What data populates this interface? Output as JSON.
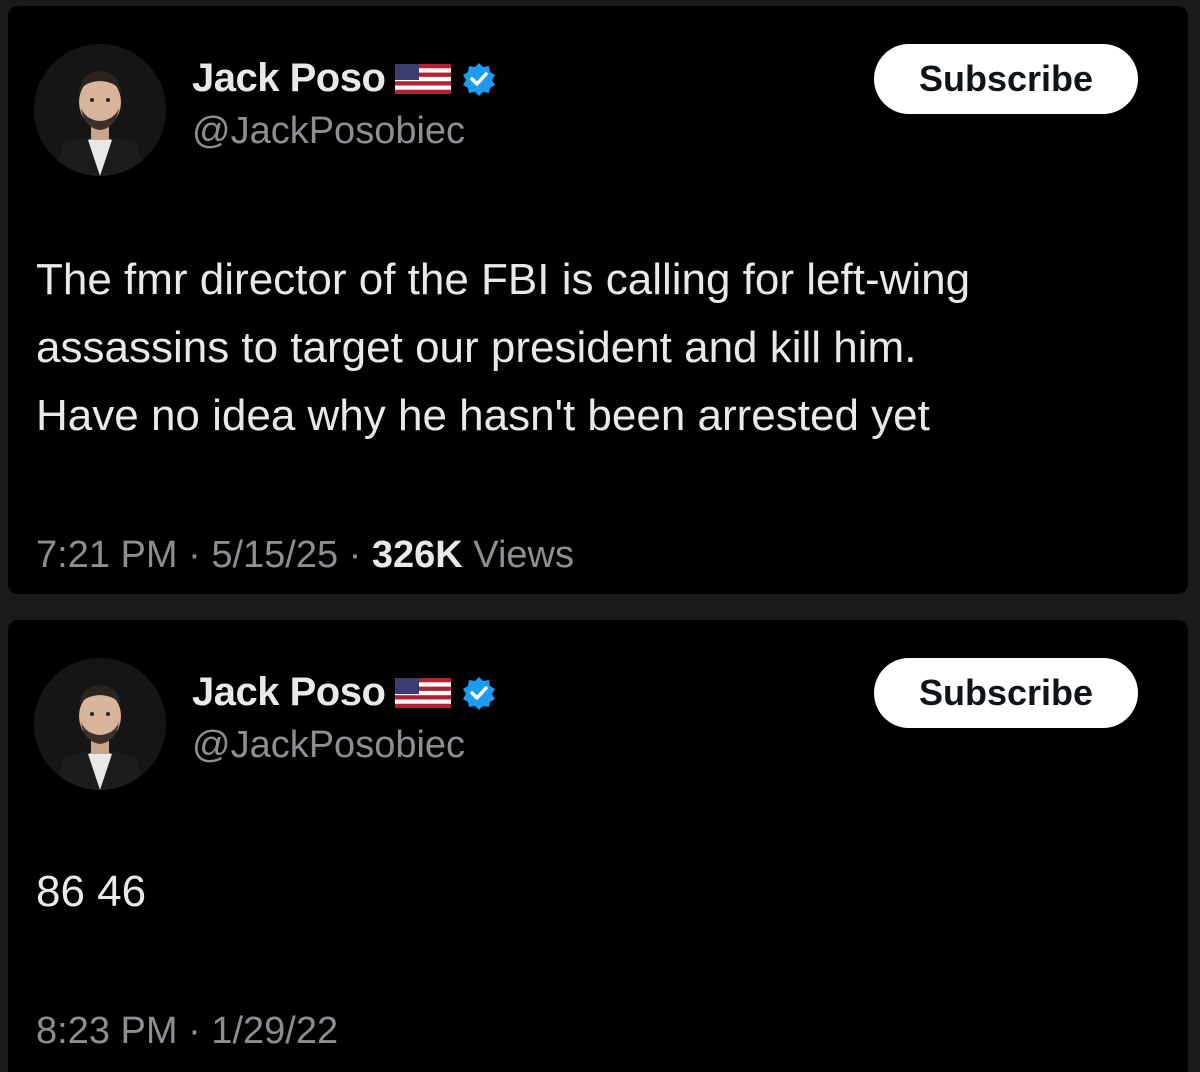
{
  "tweets": [
    {
      "display_name": "Jack Poso",
      "handle": "@JackPosobiec",
      "subscribe_label": "Subscribe",
      "text": "The fmr director of the FBI is calling for left-wing\nassassins to target our president and kill him.\nHave no idea why he hasn't been arrested yet",
      "time": "7:21 PM",
      "date": "5/15/25",
      "views_count": "326K",
      "views_label": "Views",
      "separator": "·"
    },
    {
      "display_name": "Jack Poso",
      "handle": "@JackPosobiec",
      "subscribe_label": "Subscribe",
      "text": "86 46",
      "time": "8:23 PM",
      "date": "1/29/22",
      "separator": "·"
    }
  ],
  "colors": {
    "background": "#000000",
    "text_primary": "#e7e9ea",
    "text_secondary": "#8b8f94",
    "verified_blue": "#1d9bf0",
    "button_bg": "#ffffff"
  },
  "icons": {
    "flag": "us-flag-icon",
    "verified": "verified-badge-icon",
    "avatar": "profile-avatar"
  }
}
